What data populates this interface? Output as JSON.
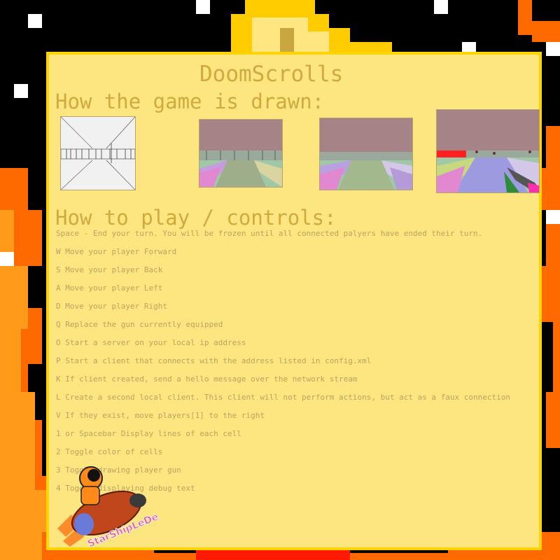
{
  "game": {
    "title": "DoomScrolls"
  },
  "sections": {
    "drawn_heading": "How the game is drawn:",
    "controls_heading": "How to play / controls:"
  },
  "controls": [
    "Space - End your turn. You will be frozen until all connected palyers have ended their turn.",
    "W Move your player Forward",
    "S Move your player Back",
    "A Move your player Left",
    "D Move your player Right",
    "Q Replace the gun currently equipped",
    "O Start a server on your local ip address",
    "P Start a client that connects with the address listed in config.xml",
    "K If client created, send a hello message over the network stream",
    "L Create a second local client. This client will not perform actions, but act as a faux connection",
    "V If they exist, move players[1] to the right",
    "1 or Spacebar Display lines of each cell",
    "2 Toggle color of cells",
    "3 Toggle drawing player gun",
    "4 Toggle displaying debug text"
  ],
  "logo": {
    "text": "StarShipLeDe"
  },
  "colors": {
    "fire_outer": "#ff6a00",
    "fire_mid": "#ff9a1a",
    "fire_inner": "#ffcc33",
    "card": "#fde57f",
    "card_border": "#ffd400",
    "heading": "#d0a93f",
    "body_text": "#b9a461"
  },
  "icons": [
    "star-pixel-icon",
    "rocket-logo-icon"
  ]
}
